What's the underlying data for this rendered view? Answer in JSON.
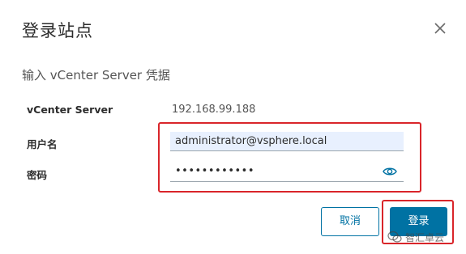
{
  "dialog": {
    "title": "登录站点",
    "subtitle": "输入 vCenter Server 凭据"
  },
  "fields": {
    "server_label": "vCenter Server",
    "server_value": "192.168.99.188",
    "username_label": "用户名",
    "username_value": "administrator@vsphere.local",
    "password_label": "密码",
    "password_masked": "••••••••••••"
  },
  "buttons": {
    "cancel_label": "取消",
    "login_label": "登录"
  },
  "watermark": {
    "text": "智汇卓云"
  },
  "colors": {
    "accent": "#0072a3",
    "highlight": "#d9252a",
    "autofill_bg": "#e8f0fe"
  },
  "icons": {
    "close": "close-icon",
    "eye": "eye-icon",
    "watermark": "wechat-icon"
  }
}
